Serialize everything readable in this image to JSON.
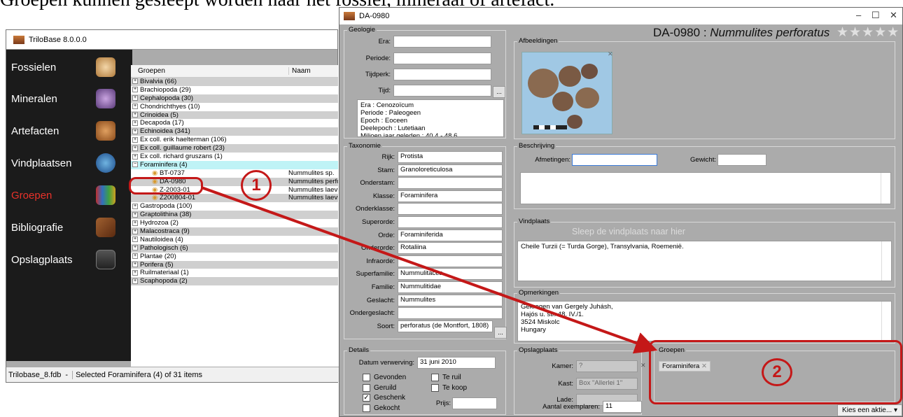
{
  "caption": "Groepen kunnen gesleept worden naar het fossiel, mineraal of artefact.",
  "main_window": {
    "title": "TriloBase 8.0.0.0",
    "nav": [
      "Fossielen",
      "Mineralen",
      "Artefacten",
      "Vindplaatsen",
      "Groepen",
      "Bibliografie",
      "Opslagplaats"
    ],
    "active_nav": "Groepen",
    "grid_headers": {
      "groups": "Groepen",
      "name": "Naam"
    },
    "groups": [
      "Bivalvia (66)",
      "Brachiopoda (29)",
      "Cephalopoda (30)",
      "Chondrichthyes (10)",
      "Crinoidea (5)",
      "Decapoda (17)",
      "Echinoidea (341)",
      "Ex coll. erik haelterman (106)",
      "Ex coll. guillaume robert (23)",
      "Ex coll. richard gruszans (1)",
      "Foraminifera (4)"
    ],
    "children": [
      {
        "id": "BT-0737",
        "name": "Nummulites sp."
      },
      {
        "id": "DA-0980",
        "name": "Nummulites perfor"
      },
      {
        "id": "Z-2003-01",
        "name": "Nummulites laeviga"
      },
      {
        "id": "Z200804-01",
        "name": "Nummulites laevig"
      }
    ],
    "groups_after": [
      "Gastropoda (100)",
      "Graptolithina (38)",
      "Hydrozoa (2)",
      "Malacostraca (9)",
      "Nautiloidea (4)",
      "Pathologisch (6)",
      "Plantae (20)",
      "Porifera (5)",
      "Ruilmateriaal (1)",
      "Scaphopoda (2)"
    ],
    "status_db": "Trilobase_8.fdb",
    "status_sep": "-",
    "status_text": "Selected Foraminifera (4) of 31 items"
  },
  "detail_window": {
    "title": "DA-0980",
    "header_id": "DA-0980 :",
    "header_species": "Nummulites perforatus",
    "stars": "★★★★★",
    "geologie": {
      "title": "Geologie",
      "labels": [
        "Era:",
        "Periode:",
        "Tijdperk:",
        "Tijd:"
      ],
      "info": "Era : Cenozoïcum\nPeriode : Paleogeen\nEpoch : Eoceen\nDeelepoch : Lutetiaan\nMiljoen jaar geleden : 40.4 - 48.6"
    },
    "afbeeldingen": "Afbeeldingen",
    "taxonomie": {
      "title": "Taxonomie",
      "rows": [
        {
          "label": "Rijk:",
          "value": "Protista"
        },
        {
          "label": "Stam:",
          "value": "Granoloreticulosa"
        },
        {
          "label": "Onderstam:",
          "value": ""
        },
        {
          "label": "Klasse:",
          "value": "Foraminifera"
        },
        {
          "label": "Onderklasse:",
          "value": ""
        },
        {
          "label": "Superorde:",
          "value": ""
        },
        {
          "label": "Orde:",
          "value": "Foraminiferida"
        },
        {
          "label": "Onderorde:",
          "value": "Rotaliina"
        },
        {
          "label": "Infraorde:",
          "value": ""
        },
        {
          "label": "Superfamilie:",
          "value": "Nummulitacea"
        },
        {
          "label": "Familie:",
          "value": "Nummulitidae"
        },
        {
          "label": "Geslacht:",
          "value": "Nummulites"
        },
        {
          "label": "Ondergeslacht:",
          "value": ""
        },
        {
          "label": "Soort:",
          "value": "perforatus (de Montfort, 1808)"
        }
      ]
    },
    "beschrijving": {
      "title": "Beschrijving",
      "afmetingen": "Afmetingen:",
      "gewicht": "Gewicht:"
    },
    "vindplaats": {
      "title": "Vindplaats",
      "hint": "Sleep de vindplaats naar hier",
      "value": "Cheile Turzii (= Turda Gorge), Transylvania, Roemenië."
    },
    "opmerkingen": {
      "title": "Opmerkingen",
      "value": "Gekregen van Gergely Juhásh,\nHajós u. str. 48. IV./1.\n3524 Miskolc\nHungary"
    },
    "details": {
      "title": "Details",
      "datum_label": "Datum verwerving:",
      "datum_value": "31 juni 2010",
      "checks": [
        {
          "label": "Gevonden",
          "checked": false
        },
        {
          "label": "Geruild",
          "checked": false
        },
        {
          "label": "Geschenk",
          "checked": true
        },
        {
          "label": "Gekocht",
          "checked": false
        }
      ],
      "checks2": [
        {
          "label": "Te ruil",
          "checked": false
        },
        {
          "label": "Te koop",
          "checked": false
        }
      ],
      "prijs": "Prijs:"
    },
    "opslagplaats": {
      "title": "Opslagplaats",
      "kamer_label": "Kamer:",
      "kamer_value": "?",
      "kast_label": "Kast:",
      "kast_value": "Box \"Allerlei 1\"",
      "lade_label": "Lade:",
      "aantal_label": "Aantal exemplaren:",
      "aantal_value": "11"
    },
    "groepen": {
      "title": "Groepen",
      "tag": "Foraminifera"
    },
    "action": "Kies een aktie... ▾"
  },
  "annotations": {
    "one": "1",
    "two": "2"
  }
}
